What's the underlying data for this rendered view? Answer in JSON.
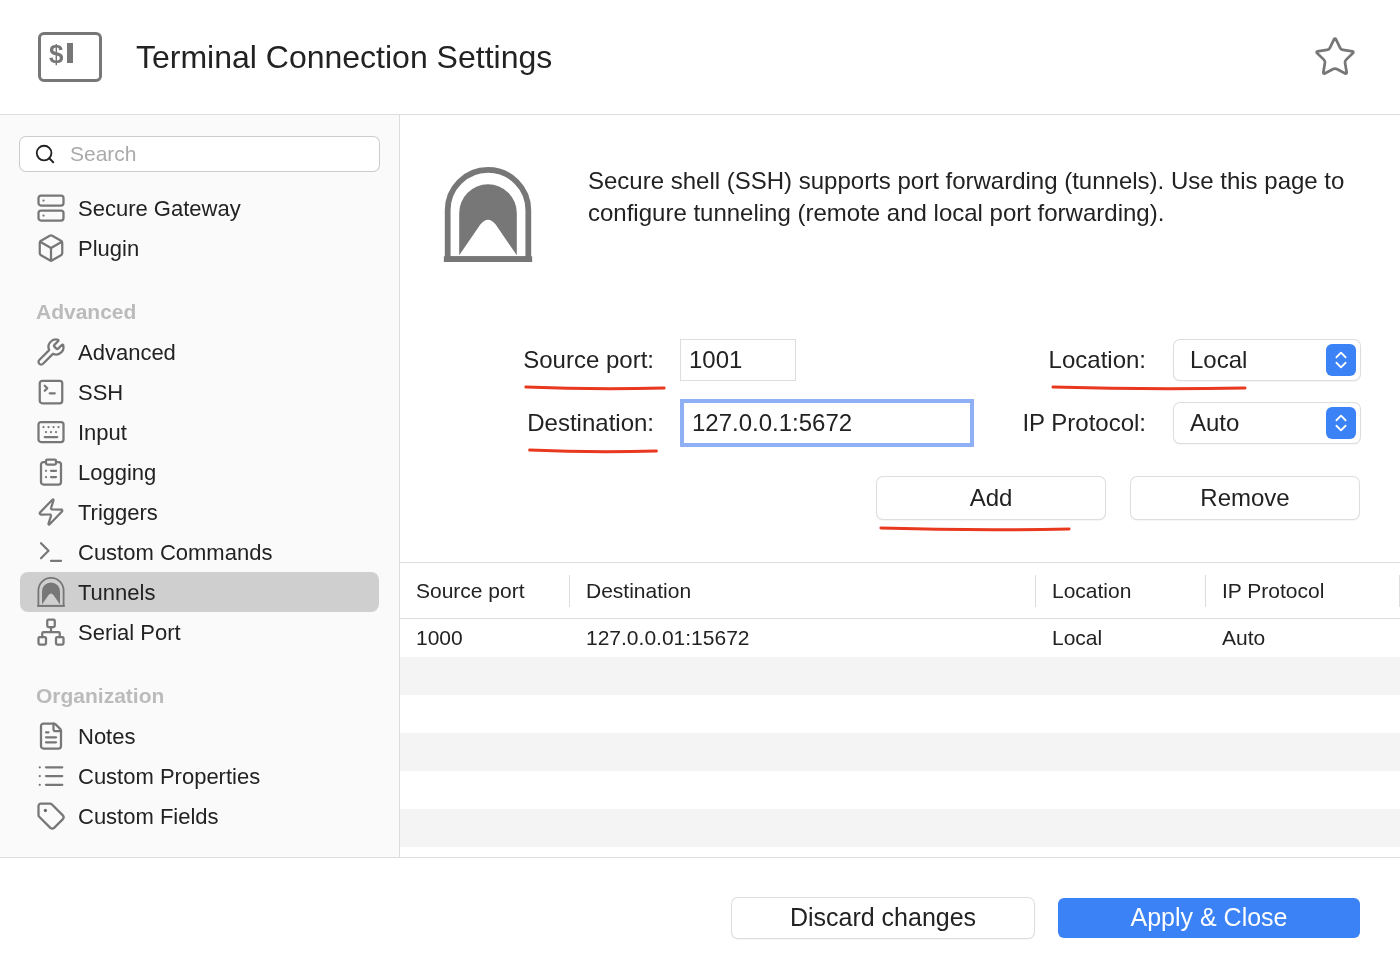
{
  "window": {
    "title": "Terminal Connection Settings",
    "logo_text": "$"
  },
  "sidebar": {
    "search": {
      "placeholder": "Search"
    },
    "sections": [
      {
        "items": [
          {
            "label": "Secure Gateway",
            "selected": false
          },
          {
            "label": "Plugin",
            "selected": false
          }
        ]
      },
      {
        "heading": "Advanced",
        "items": [
          {
            "label": "Advanced",
            "selected": false
          },
          {
            "label": "SSH",
            "selected": false
          },
          {
            "label": "Input",
            "selected": false
          },
          {
            "label": "Logging",
            "selected": false
          },
          {
            "label": "Triggers",
            "selected": false
          },
          {
            "label": "Custom Commands",
            "selected": false
          },
          {
            "label": "Tunnels",
            "selected": true
          },
          {
            "label": "Serial Port",
            "selected": false
          }
        ]
      },
      {
        "heading": "Organization",
        "items": [
          {
            "label": "Notes",
            "selected": false
          },
          {
            "label": "Custom Properties",
            "selected": false
          },
          {
            "label": "Custom Fields",
            "selected": false
          }
        ]
      }
    ]
  },
  "intro": "Secure shell (SSH) supports port forwarding (tunnels). Use this page to configure tunneling (remote and local port forwarding).",
  "form": {
    "source_port": {
      "label": "Source port:",
      "value": "1001",
      "underlined": true
    },
    "destination": {
      "label": "Destination:",
      "value": "127.0.0.1:5672",
      "focused": true,
      "underlined": true
    },
    "location": {
      "label": "Location:",
      "value": "Local",
      "underlined": true
    },
    "ip_protocol": {
      "label": "IP Protocol:",
      "value": "Auto",
      "underlined": false
    },
    "buttons": [
      {
        "label": "Add",
        "underlined": true
      },
      {
        "label": "Remove",
        "underlined": false
      }
    ]
  },
  "table": {
    "columns": [
      "Source port",
      "Destination",
      "Location",
      "IP Protocol"
    ],
    "rows": [
      [
        "1000",
        "127.0.0.01:15672",
        "Local",
        "Auto"
      ]
    ]
  },
  "footer": {
    "buttons": [
      {
        "label": "Discard changes",
        "kind": "secondary"
      },
      {
        "label": "Apply & Close",
        "kind": "primary"
      }
    ]
  }
}
